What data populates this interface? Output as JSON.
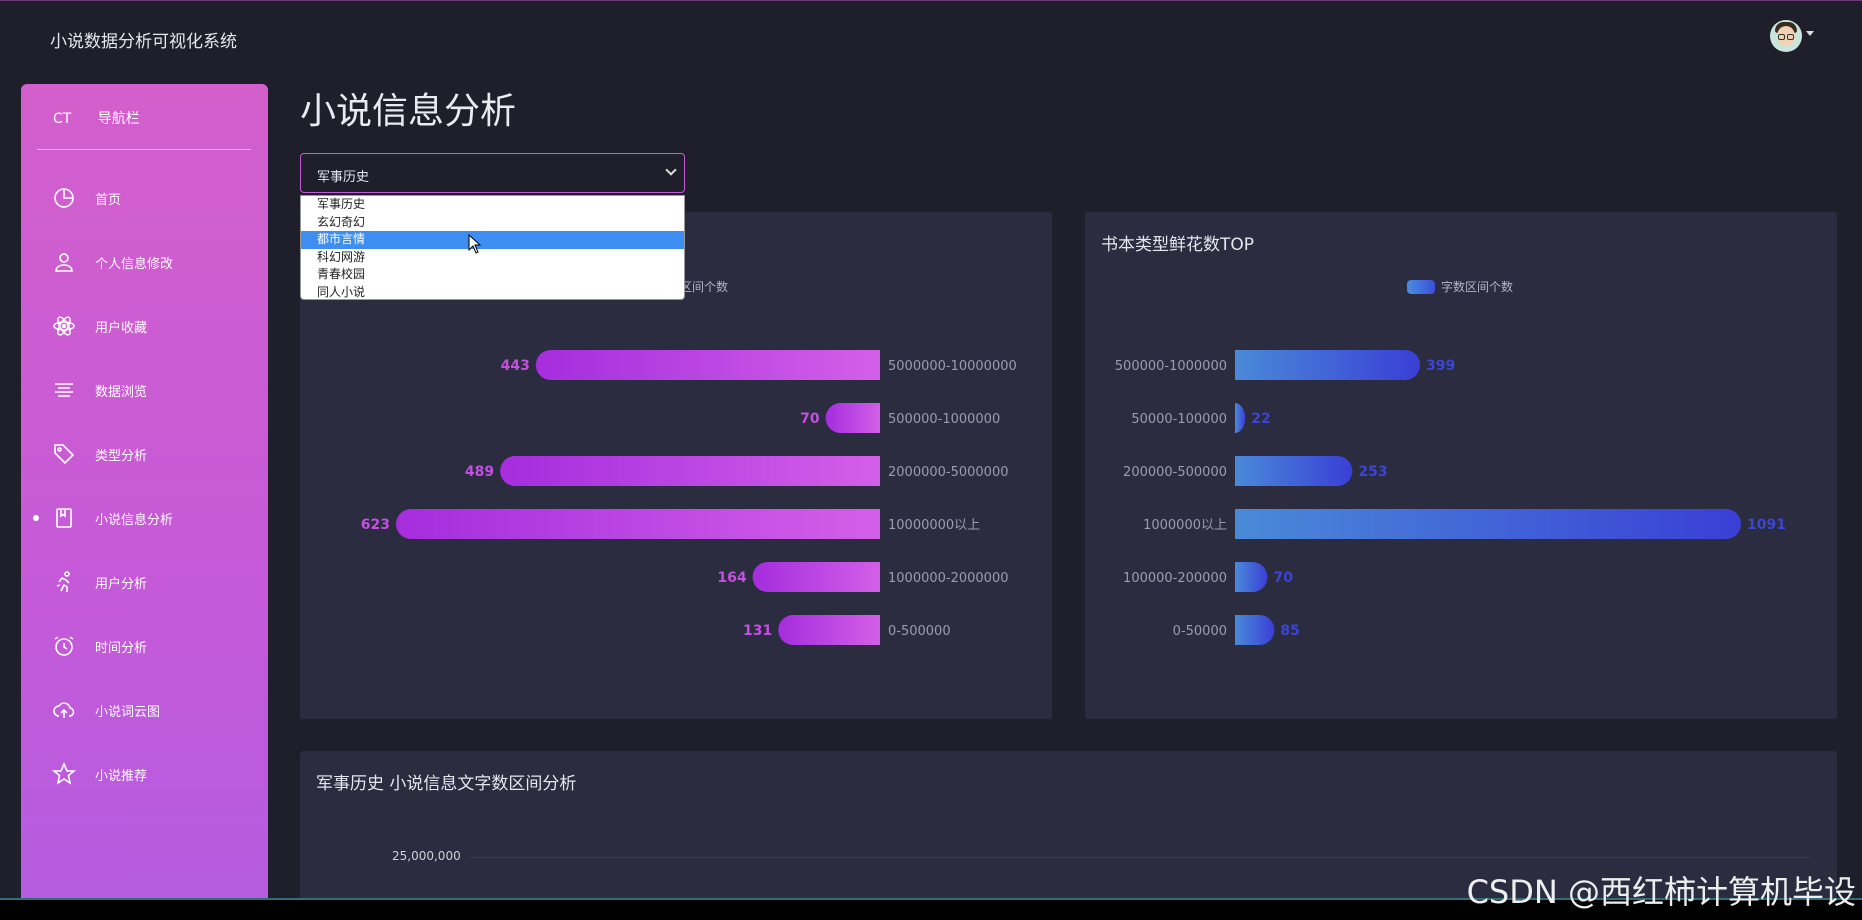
{
  "app": {
    "title": "小说数据分析可视化系统"
  },
  "sidebar": {
    "brand": "CT",
    "heading": "导航栏",
    "items": [
      {
        "label": "首页",
        "icon": "pie-chart-icon"
      },
      {
        "label": "个人信息修改",
        "icon": "user-icon"
      },
      {
        "label": "用户收藏",
        "icon": "atom-icon"
      },
      {
        "label": "数据浏览",
        "icon": "align-center-icon"
      },
      {
        "label": "类型分析",
        "icon": "tag-icon"
      },
      {
        "label": "小说信息分析",
        "icon": "book-icon",
        "active": true
      },
      {
        "label": "用户分析",
        "icon": "run-icon"
      },
      {
        "label": "时间分析",
        "icon": "alarm-icon"
      },
      {
        "label": "小说词云图",
        "icon": "cloud-upload-icon"
      },
      {
        "label": "小说推荐",
        "icon": "star-icon"
      }
    ]
  },
  "page": {
    "title": "小说信息分析"
  },
  "select": {
    "value": "军事历史",
    "options": [
      "军事历史",
      "玄幻奇幻",
      "都市言情",
      "科幻网游",
      "青春校园",
      "同人小说"
    ],
    "highlighted": "都市言情"
  },
  "left_card": {
    "legend_partial": "区间个数"
  },
  "right_card": {
    "title": "书本类型鲜花数TOP",
    "legend": "字数区间个数"
  },
  "bottom_card": {
    "title": "军事历史 小说信息文字数区间分析",
    "ytick": "25,000,000"
  },
  "watermark": "CSDN @西红柿计算机毕设",
  "colors": {
    "accent": "#c55ad8",
    "purple_bar": "#b64ae0",
    "blue_bar": "#3a4fd8",
    "bg": "#1f1e2b",
    "card": "#2b2c40"
  },
  "chart_data": [
    {
      "type": "bar",
      "orientation": "horizontal-mirrored",
      "categories": [
        "5000000-10000000",
        "500000-1000000",
        "2000000-5000000",
        "10000000以上",
        "1000000-2000000",
        "0-500000"
      ],
      "values": [
        443,
        70,
        489,
        623,
        164,
        131
      ],
      "legend": "区间个数"
    },
    {
      "type": "bar",
      "orientation": "horizontal",
      "title": "书本类型鲜花数TOP",
      "categories": [
        "500000-1000000",
        "50000-100000",
        "200000-500000",
        "1000000以上",
        "100000-200000",
        "0-50000"
      ],
      "values": [
        399,
        22,
        253,
        1091,
        70,
        85
      ],
      "legend": "字数区间个数"
    }
  ]
}
